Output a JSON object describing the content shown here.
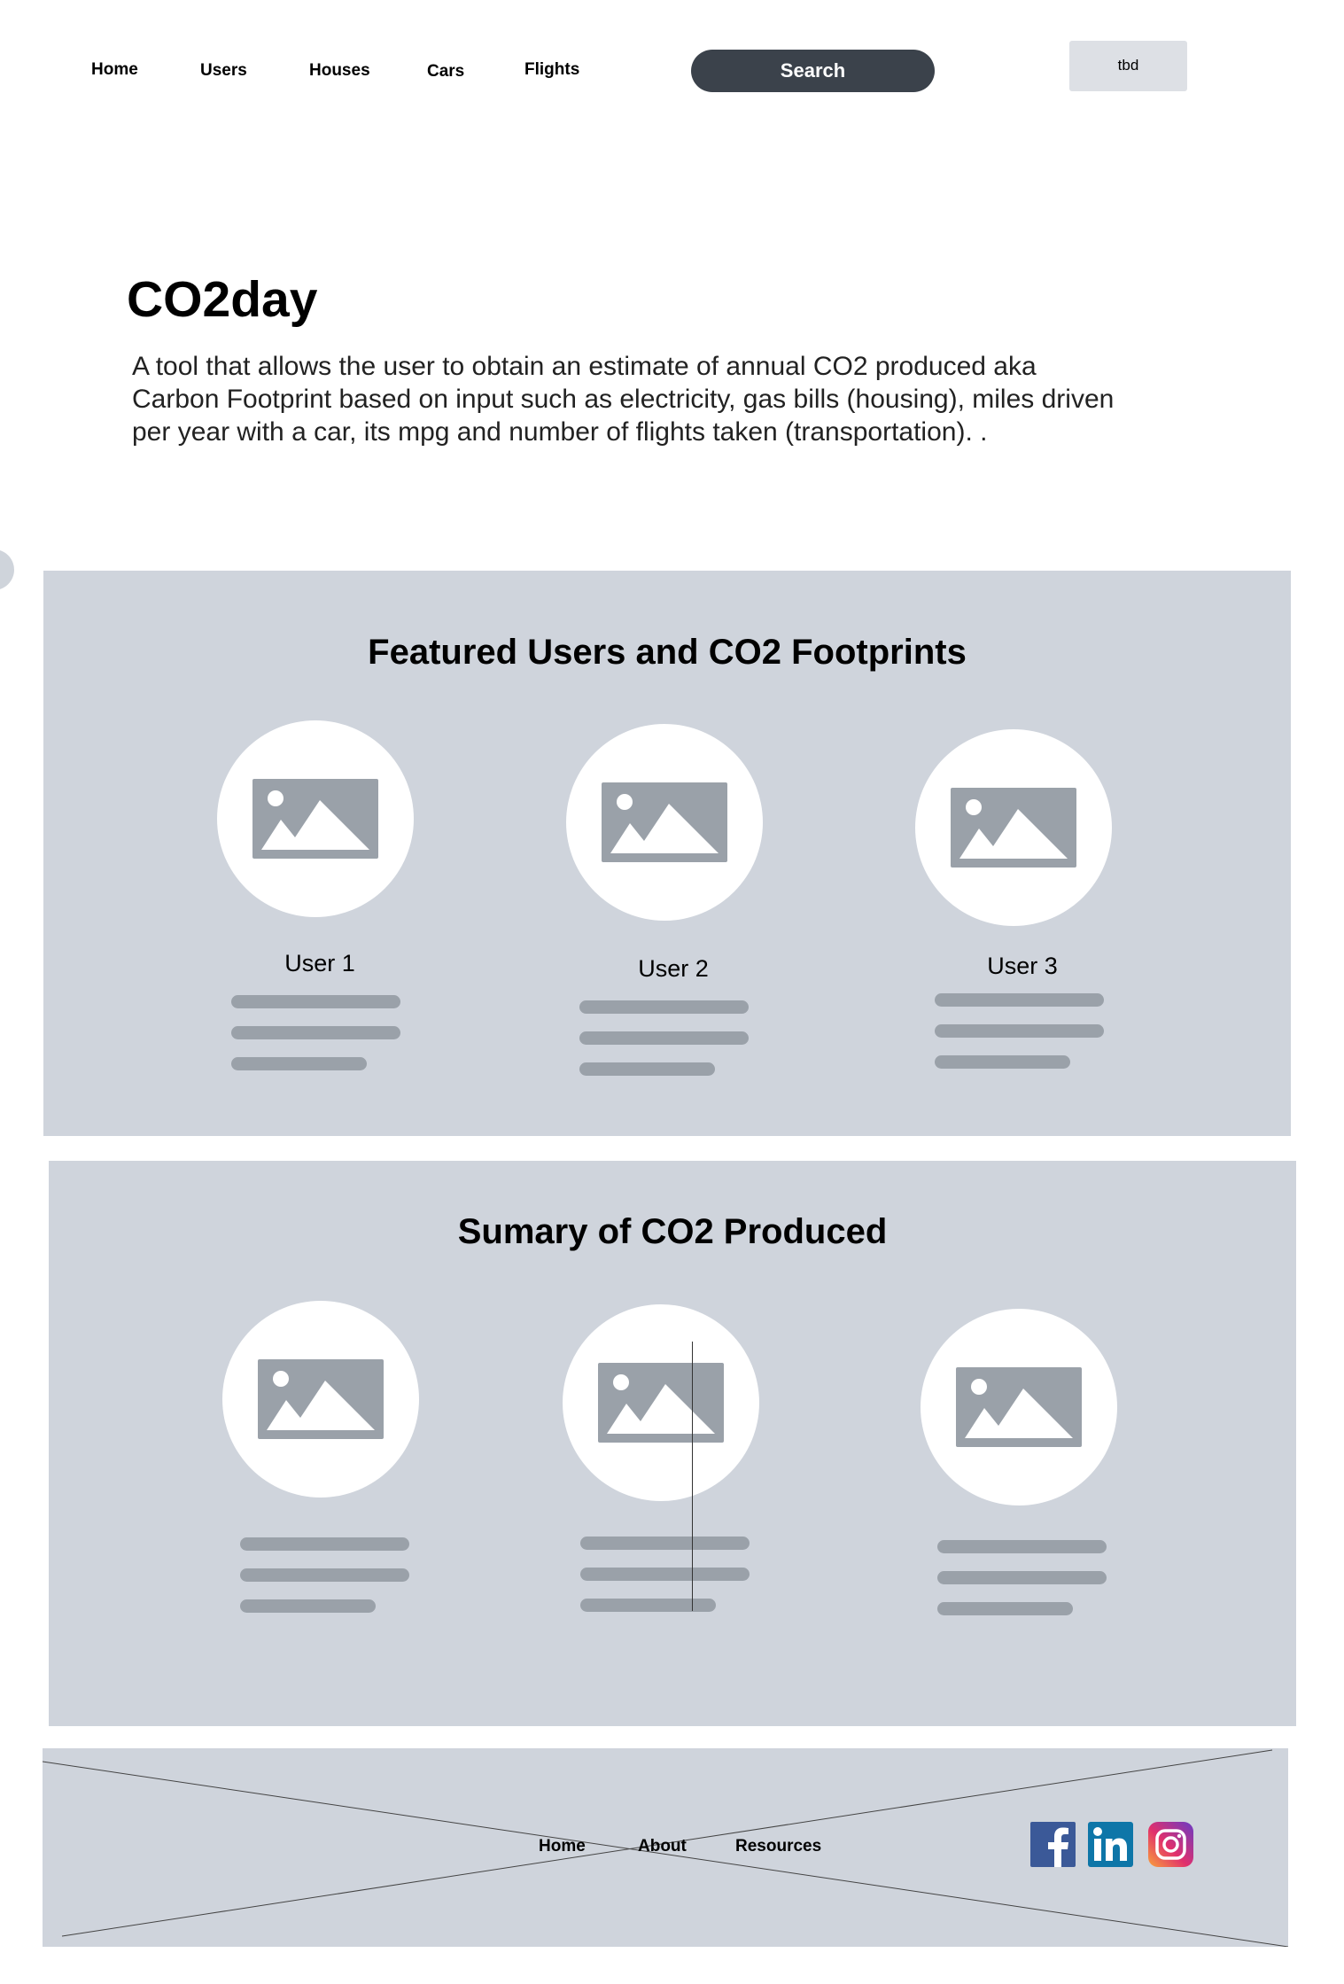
{
  "nav": {
    "links": [
      "Home",
      "Users",
      "Houses",
      "Cars",
      "Flights"
    ],
    "search_label": "Search",
    "tbd_label": "tbd"
  },
  "hero": {
    "title": "CO2day",
    "description": "A tool that allows the user to obtain an estimate of annual CO2 produced aka Carbon Footprint based on input such as electricity, gas bills (housing), miles driven per year with a car, its mpg and number of flights taken (transportation). ."
  },
  "featured": {
    "title": "Featured Users and CO2 Footprints",
    "users": [
      {
        "name": "User 1"
      },
      {
        "name": "User 2"
      },
      {
        "name": "User 3"
      }
    ]
  },
  "summary": {
    "title": "Sumary of CO2 Produced"
  },
  "footer": {
    "links": [
      "Home",
      "About",
      "Resources"
    ],
    "social_icons": [
      "facebook-icon",
      "linkedin-icon",
      "instagram-icon"
    ]
  },
  "colors": {
    "panel": "#cfd4dc",
    "placeholder": "#9aa1a9",
    "search_button": "#3b424b",
    "facebook": "#3b5998",
    "linkedin": "#0e76a8"
  }
}
